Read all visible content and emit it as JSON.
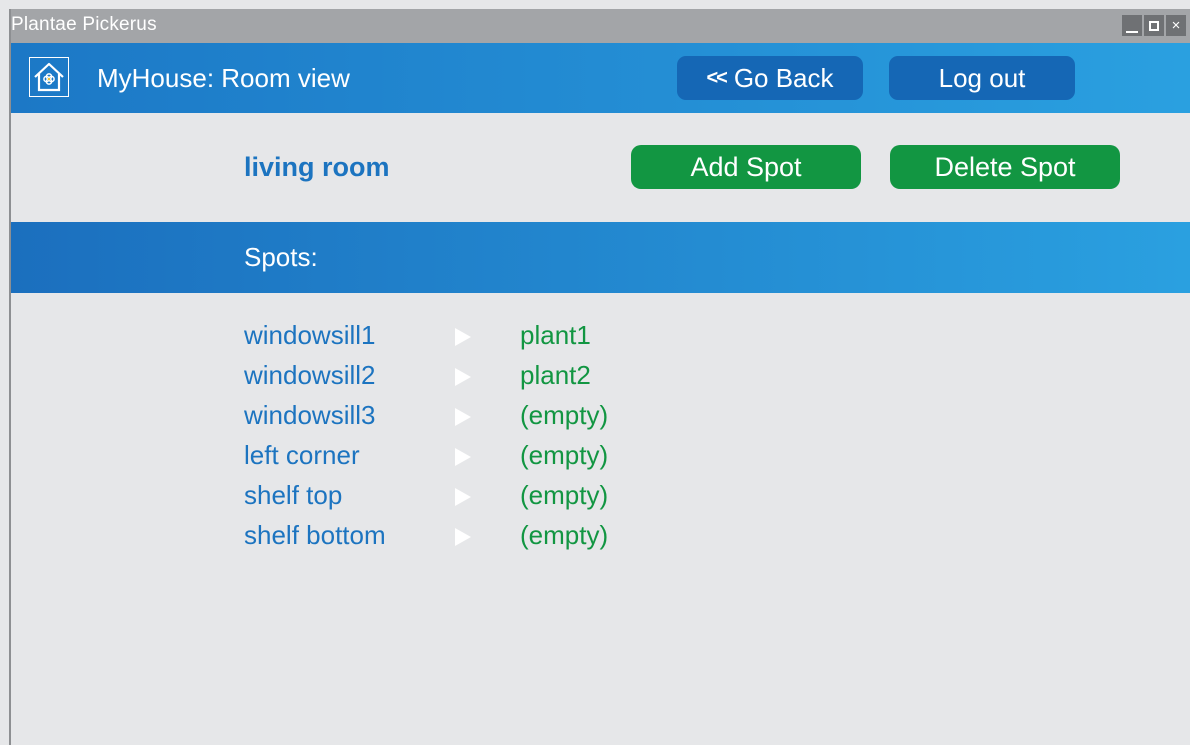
{
  "window": {
    "title": "Plantae Pickerus",
    "controls": [
      "minimize-icon",
      "maximize-icon",
      "close-icon"
    ],
    "close_glyph": "×"
  },
  "appbar": {
    "icon": "house-flower-icon",
    "title": "MyHouse: Room view",
    "back_chevron": "<<",
    "back_label": "Go Back",
    "logout_label": "Log out"
  },
  "room": {
    "name": "living room",
    "add_label": "Add Spot",
    "delete_label": "Delete Spot"
  },
  "spots_section": {
    "heading": "Spots:",
    "arrow_icon": "triangle-right-icon",
    "items": [
      {
        "spot": "windowsill1",
        "plant": "plant1"
      },
      {
        "spot": "windowsill2",
        "plant": "plant2"
      },
      {
        "spot": "windowsill3",
        "plant": "(empty)"
      },
      {
        "spot": "left corner",
        "plant": "(empty)"
      },
      {
        "spot": "shelf top",
        "plant": "(empty)"
      },
      {
        "spot": "shelf bottom",
        "plant": "(empty)"
      }
    ]
  },
  "colors": {
    "accent_blue": "#1c74c0",
    "bar_gradient_start": "#1c78c6",
    "bar_gradient_end": "#2aa0e0",
    "nav_button": "#1567b5",
    "action_green": "#129642",
    "background": "#e6e7e9",
    "titlebar": "#a3a5a8"
  }
}
